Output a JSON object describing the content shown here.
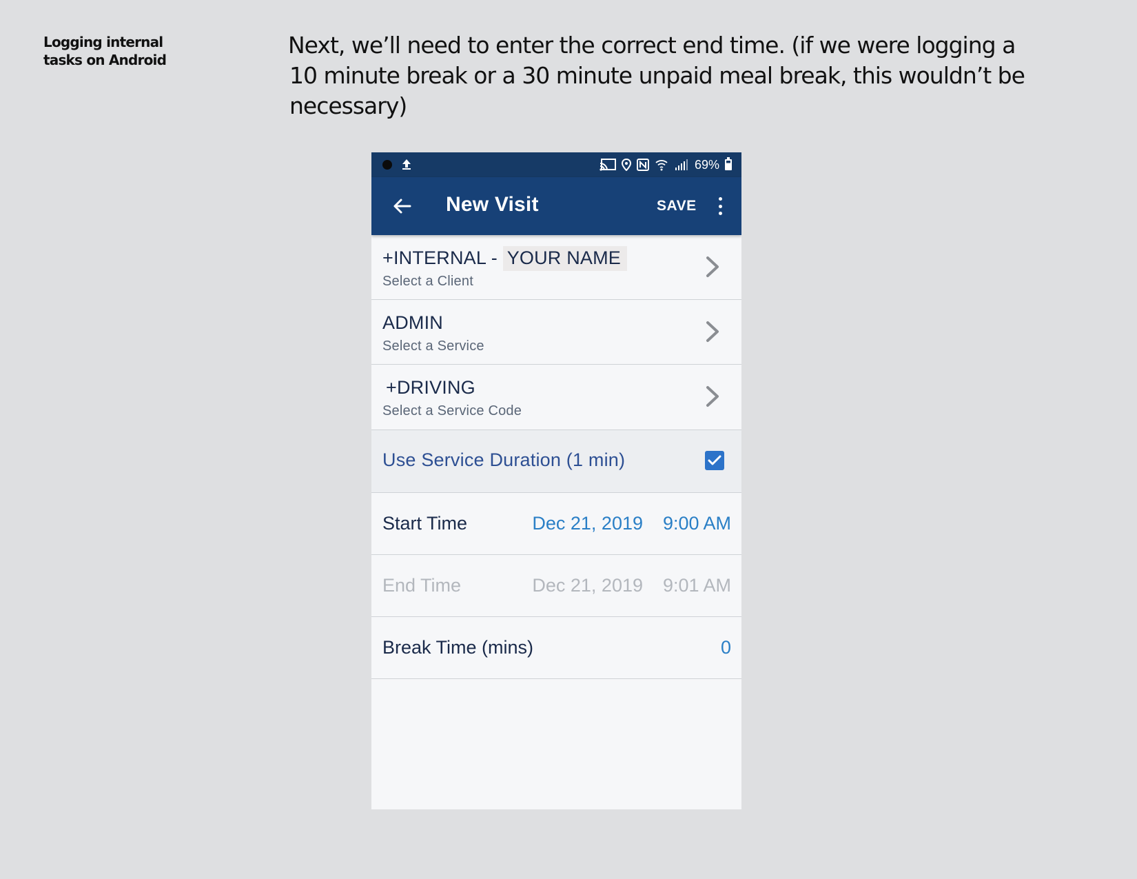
{
  "slide": {
    "side_title": "Logging internal\ntasks on Android",
    "instruction_line1": "Next, we’ll need to enter the correct end time. (if we were logging a",
    "instruction_line2": "10 minute break or a 30 minute unpaid meal break, this wouldn’t be necessary)"
  },
  "status_bar": {
    "battery": "69%",
    "icons": [
      "record-dot-icon",
      "upload-icon",
      "cast-icon",
      "location-icon",
      "nfc-icon",
      "wifi-icon",
      "signal-icon",
      "battery-icon"
    ]
  },
  "app_bar": {
    "title": "New Visit",
    "save_label": "SAVE",
    "colors": {
      "app_bar": "#174177",
      "status_bar": "#163a66"
    }
  },
  "form": {
    "client": {
      "value_prefix": "+INTERNAL - ",
      "value_name": "YOUR NAME",
      "hint": "Select a Client"
    },
    "service": {
      "value": "ADMIN",
      "hint": "Select a Service"
    },
    "service_code": {
      "value": "+DRIVING",
      "hint": "Select a Service Code"
    },
    "use_duration": {
      "label": "Use Service Duration (1 min)",
      "checked": true
    },
    "start_time": {
      "label": "Start Time",
      "date": "Dec 21, 2019",
      "time": "9:00 AM"
    },
    "end_time": {
      "label": "End Time",
      "date": "Dec 21, 2019",
      "time": "9:01 AM",
      "enabled": false
    },
    "break_time": {
      "label": "Break Time (mins)",
      "value": "0"
    }
  },
  "colors": {
    "accent": "#2a7fc6",
    "checkbox": "#2c73c9",
    "background": "#dedfe1"
  }
}
